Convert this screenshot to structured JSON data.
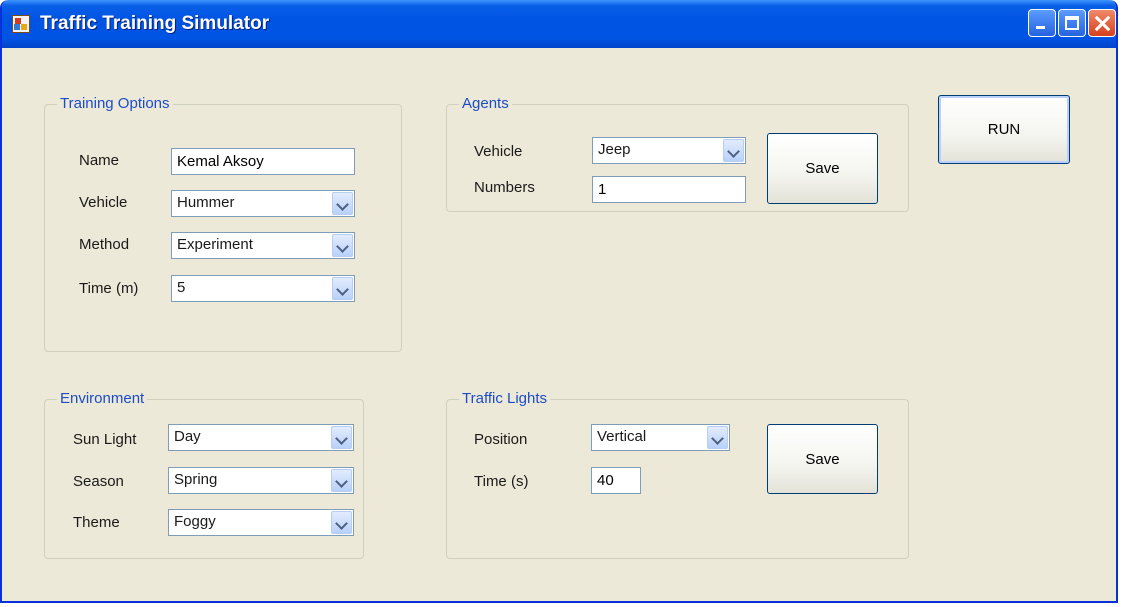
{
  "window": {
    "title": "Traffic Training Simulator"
  },
  "training_options": {
    "title": "Training Options",
    "name_label": "Name",
    "name_value": "Kemal Aksoy",
    "vehicle_label": "Vehicle",
    "vehicle_value": "Hummer",
    "method_label": "Method",
    "method_value": "Experiment",
    "time_label": "Time (m)",
    "time_value": "5"
  },
  "agents": {
    "title": "Agents",
    "vehicle_label": "Vehicle",
    "vehicle_value": "Jeep",
    "numbers_label": "Numbers",
    "numbers_value": "1",
    "save_label": "Save"
  },
  "run_button": {
    "label": "RUN"
  },
  "environment": {
    "title": "Environment",
    "sunlight_label": "Sun Light",
    "sunlight_value": "Day",
    "season_label": "Season",
    "season_value": "Spring",
    "theme_label": "Theme",
    "theme_value": "Foggy"
  },
  "traffic_lights": {
    "title": "Traffic Lights",
    "position_label": "Position",
    "position_value": "Vertical",
    "time_label": "Time (s)",
    "time_value": "40",
    "save_label": "Save"
  },
  "icons": {
    "app": "app-window-icon",
    "minimize": "minimize-icon",
    "maximize": "maximize-icon",
    "close": "close-icon",
    "dropdown": "chevron-down-icon"
  }
}
